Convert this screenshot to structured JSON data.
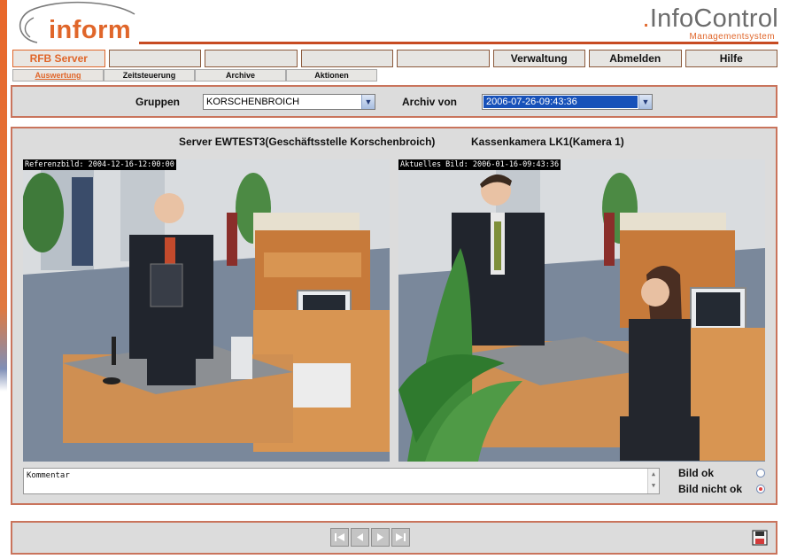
{
  "logo": {
    "text_main": "inform"
  },
  "brand": {
    "name_prefix": ".",
    "name": "InfoControl",
    "subtitle": "Managementsystem"
  },
  "menu": {
    "items": [
      {
        "label": "RFB Server",
        "active": true
      },
      {
        "label": ""
      },
      {
        "label": ""
      },
      {
        "label": ""
      },
      {
        "label": ""
      },
      {
        "label": "Verwaltung"
      },
      {
        "label": "Abmelden"
      },
      {
        "label": "Hilfe"
      }
    ]
  },
  "submenu": {
    "items": [
      {
        "label": "Auswertung",
        "active": true
      },
      {
        "label": "Zeitsteuerung"
      },
      {
        "label": "Archive"
      },
      {
        "label": "Aktionen"
      }
    ]
  },
  "filter": {
    "gruppen_label": "Gruppen",
    "gruppen_value": "KORSCHENBROICH",
    "archiv_label": "Archiv von",
    "archiv_value": "2006-07-26-09:43:36"
  },
  "main": {
    "server_title": "Server EWTEST3(Geschäftsstelle Korschenbroich)",
    "camera_title": "Kassenkamera LK1(Kamera 1)",
    "reference_label": "Referenzbild: 2004-12-16-12:00:00",
    "current_label": "Aktuelles Bild: 2006-01-16-09:43:36",
    "comment_text": "Kommentar",
    "bild_ok_label": "Bild ok",
    "bild_nicht_ok_label": "Bild nicht ok",
    "selected_status": "Bild nicht ok"
  },
  "nav": {
    "icons": [
      "first-icon",
      "previous-icon",
      "next-icon",
      "last-icon",
      "save-icon"
    ]
  },
  "colors": {
    "accent": "#e0662a",
    "panel_border": "#c9745c",
    "panel_bg": "#dcdcdc",
    "selection": "#1751b9"
  }
}
